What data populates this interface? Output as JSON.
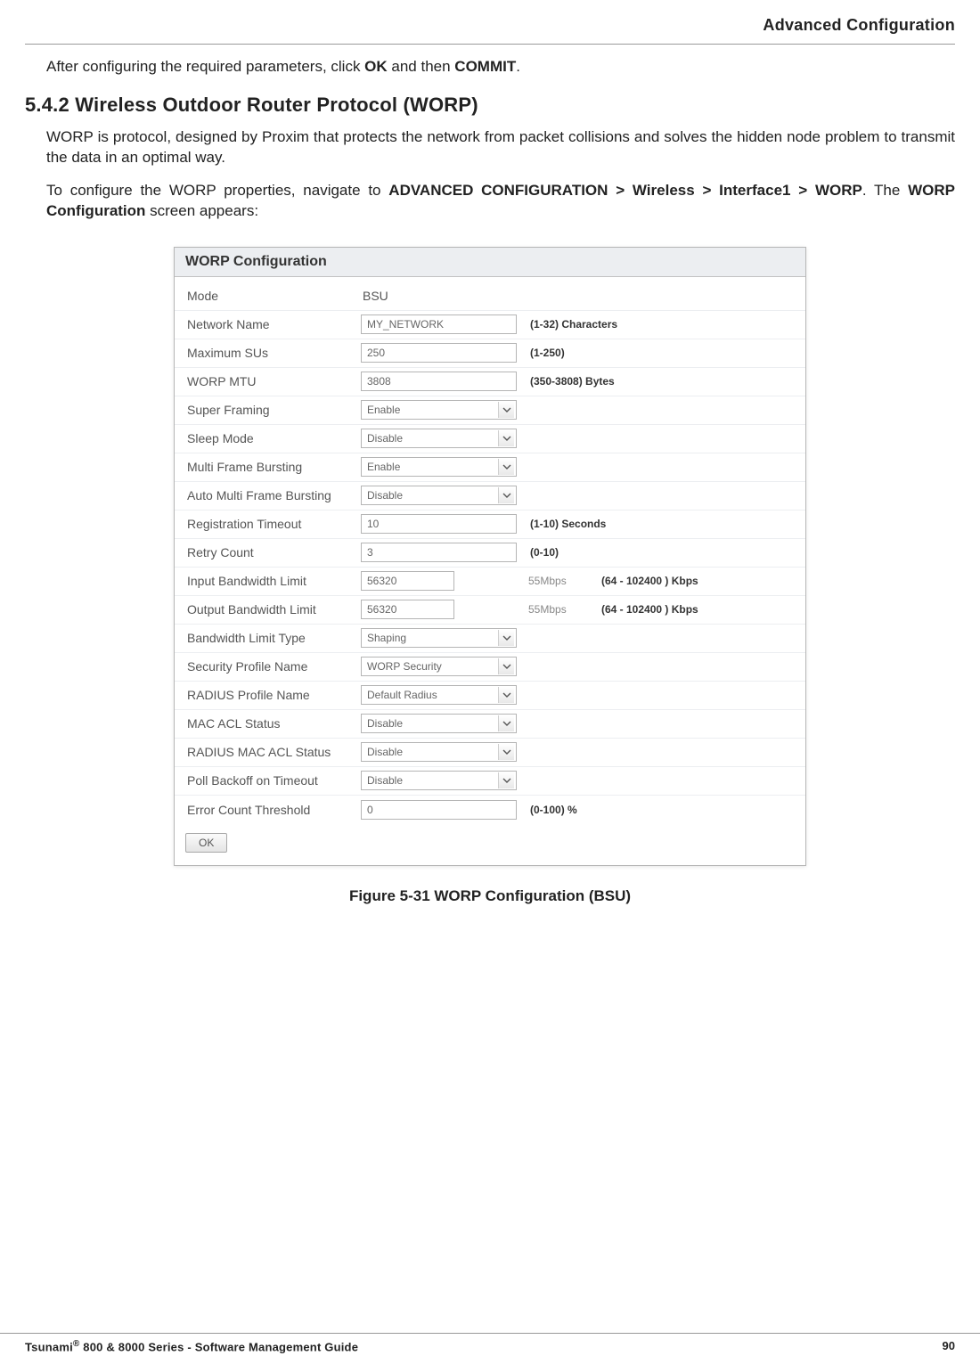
{
  "header": {
    "title": "Advanced Configuration"
  },
  "intro": {
    "p1_a": "After configuring the required parameters, click ",
    "p1_b": "OK",
    "p1_c": " and then ",
    "p1_d": "COMMIT",
    "p1_e": "."
  },
  "section": {
    "number_title": "5.4.2 Wireless Outdoor Router Protocol (WORP)"
  },
  "para": {
    "p2": "WORP is protocol, designed by Proxim that protects the network from packet collisions and solves the hidden node problem to transmit the data in an optimal way.",
    "p3_a": "To configure the WORP properties, navigate to ",
    "p3_b": "ADVANCED CONFIGURATION > Wireless > Interface1 > WORP",
    "p3_c": ". The ",
    "p3_d": "WORP Configuration",
    "p3_e": " screen appears:"
  },
  "panel": {
    "title": "WORP Configuration"
  },
  "fields": {
    "mode": {
      "label": "Mode",
      "value": "BSU"
    },
    "network_name": {
      "label": "Network Name",
      "value": "MY_NETWORK",
      "hint": "(1-32) Characters"
    },
    "max_sus": {
      "label": "Maximum SUs",
      "value": "250",
      "hint": "(1-250)"
    },
    "worp_mtu": {
      "label": "WORP MTU",
      "value": "3808",
      "hint": "(350-3808) Bytes"
    },
    "super_framing": {
      "label": "Super Framing",
      "value": "Enable"
    },
    "sleep_mode": {
      "label": "Sleep Mode",
      "value": "Disable"
    },
    "mfb": {
      "label": "Multi Frame Bursting",
      "value": "Enable"
    },
    "amfb": {
      "label": "Auto Multi Frame Bursting",
      "value": "Disable"
    },
    "reg_timeout": {
      "label": "Registration Timeout",
      "value": "10",
      "hint": "(1-10) Seconds"
    },
    "retry_count": {
      "label": "Retry Count",
      "value": "3",
      "hint": "(0-10)"
    },
    "in_bw": {
      "label": "Input Bandwidth Limit",
      "value": "56320",
      "extra": "55Mbps",
      "hint": "(64 - 102400 ) Kbps"
    },
    "out_bw": {
      "label": "Output Bandwidth Limit",
      "value": "56320",
      "extra": "55Mbps",
      "hint": "(64 - 102400 ) Kbps"
    },
    "bw_type": {
      "label": "Bandwidth Limit Type",
      "value": "Shaping"
    },
    "sec_profile": {
      "label": "Security Profile Name",
      "value": "WORP Security"
    },
    "radius_profile": {
      "label": "RADIUS Profile Name",
      "value": "Default Radius"
    },
    "mac_acl": {
      "label": "MAC ACL Status",
      "value": "Disable"
    },
    "radius_mac_acl": {
      "label": "RADIUS MAC ACL Status",
      "value": "Disable"
    },
    "poll_backoff": {
      "label": "Poll Backoff on Timeout",
      "value": "Disable"
    },
    "err_thresh": {
      "label": "Error Count Threshold",
      "value": "0",
      "hint": "(0-100) %"
    }
  },
  "buttons": {
    "ok": "OK"
  },
  "caption": {
    "text": "Figure 5-31 WORP Configuration (BSU)"
  },
  "footer": {
    "left_a": "Tsunami",
    "left_b": " 800 & 8000 Series - Software Management Guide",
    "page": "90"
  }
}
